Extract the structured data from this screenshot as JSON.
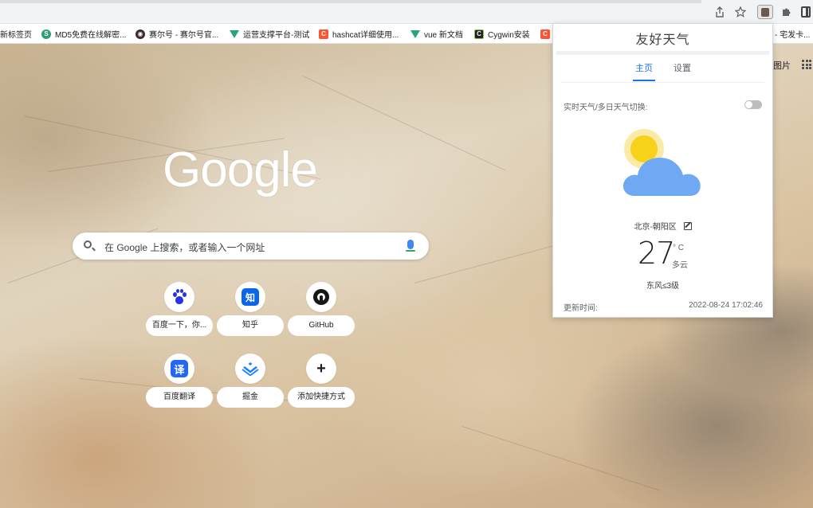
{
  "bookmarks": [
    {
      "label": "新标签页",
      "icon": "none"
    },
    {
      "label": "MD5免费在线解密...",
      "icon": "md5-icon"
    },
    {
      "label": "赛尔号 - 赛尔号官...",
      "icon": "seer-icon"
    },
    {
      "label": "运营支撑平台-测试",
      "icon": "vue-icon"
    },
    {
      "label": "hashcat详细使用...",
      "icon": "csdn-icon"
    },
    {
      "label": "vue 新文档",
      "icon": "vue-icon"
    },
    {
      "label": "Cygwin安装",
      "icon": "cygwin-icon"
    },
    {
      "label": "C",
      "icon": "csdn-icon"
    },
    {
      "label": "- 宅发卡...",
      "icon": "none"
    }
  ],
  "ntp": {
    "logo_text": "Google",
    "search_placeholder": "在 Google 上搜索，或者输入一个网址",
    "images_link": "图片",
    "shortcuts": [
      {
        "label": "百度一下，你...",
        "icon": "baidu-paw-icon"
      },
      {
        "label": "知乎",
        "icon": "zhihu-icon",
        "glyph": "知"
      },
      {
        "label": "GitHub",
        "icon": "github-icon"
      },
      {
        "label": "百度翻译",
        "icon": "baidu-translate-icon",
        "glyph": "译"
      },
      {
        "label": "掘金",
        "icon": "juejin-icon"
      },
      {
        "label": "添加快捷方式",
        "icon": "plus-icon",
        "glyph": "+"
      }
    ]
  },
  "weather": {
    "title": "友好天气",
    "tabs": [
      {
        "label": "主页",
        "active": true
      },
      {
        "label": "设置",
        "active": false
      }
    ],
    "switch_label": "实时天气/多日天气切换:",
    "switch_on": false,
    "weather_icon": "partly-cloudy-icon",
    "location": "北京-朝阳区",
    "temperature": "27",
    "unit": "° C",
    "condition": "多云",
    "wind": "东风≤3级",
    "updated_label": "更新时间:",
    "updated_time": "2022-08-24 17:02:46"
  },
  "colors": {
    "accent": "#1a73e8",
    "sun": "#f7d21a",
    "sun_glow": "#fbe9a6",
    "cloud": "#6fa8f3"
  }
}
